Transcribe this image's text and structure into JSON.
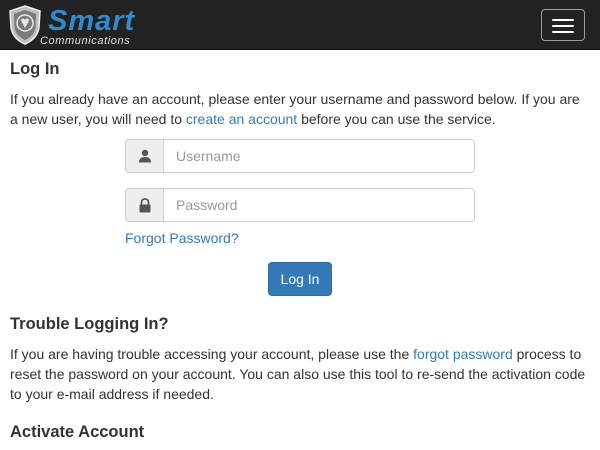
{
  "navbar": {
    "brand_name": "Smart",
    "brand_sub": "Communications",
    "toggle_icon": "hamburger-menu-icon"
  },
  "login": {
    "heading": "Log In",
    "intro_before": "If you already have an account, please enter your username and password below. If you are a new user, you will need to ",
    "create_account_link": "create an account",
    "intro_after": " before you can use the service.",
    "username_icon": "user-icon",
    "username_placeholder": "Username",
    "username_value": "",
    "password_icon": "lock-icon",
    "password_placeholder": "Password",
    "password_value": "",
    "forgot_link": "Forgot Password?",
    "submit_label": "Log In"
  },
  "trouble": {
    "heading": "Trouble Logging In?",
    "text_before": "If you are having trouble accessing your account, please use the ",
    "forgot_link": "forgot password",
    "text_after": " process to reset the password on your account. You can also use this tool to re-send the activation code to your e-mail address if needed."
  },
  "activate": {
    "heading": "Activate Account"
  },
  "colors": {
    "navbar_bg": "#222222",
    "brand_blue": "#2e8ccf",
    "link": "#337ab7",
    "primary_button": "#337ab7"
  }
}
